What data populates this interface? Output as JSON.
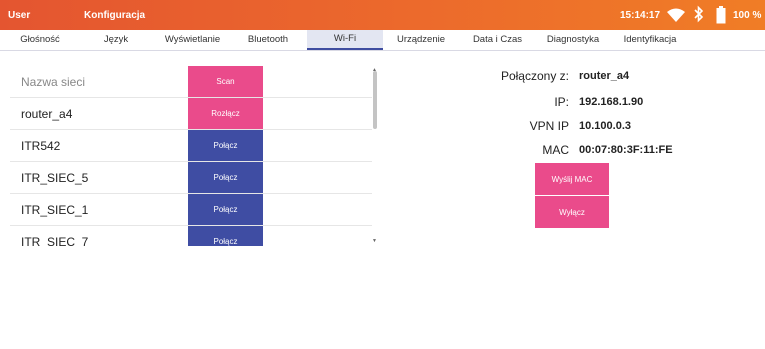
{
  "statusbar": {
    "user": "User",
    "title": "Konfiguracja",
    "time": "15:14:17",
    "battery": "100 %"
  },
  "tabs": [
    {
      "label": "Głośność"
    },
    {
      "label": "Język"
    },
    {
      "label": "Wyświetlanie"
    },
    {
      "label": "Bluetooth"
    },
    {
      "label": "Wi-Fi",
      "active": true
    },
    {
      "label": "Urządzenie"
    },
    {
      "label": "Data i Czas"
    },
    {
      "label": "Diagnostyka"
    },
    {
      "label": "Identyfikacja"
    }
  ],
  "networks": {
    "header": "Nazwa sieci",
    "scan_label": "Scan",
    "rows": [
      {
        "name": "router_a4",
        "action": "Rozłącz"
      },
      {
        "name": "ITR542",
        "action": "Połącz"
      },
      {
        "name": "ITR_SIEC_5",
        "action": "Połącz"
      },
      {
        "name": "ITR_SIEC_1",
        "action": "Połącz"
      },
      {
        "name": "ITR_SIEC_7",
        "action": "Połącz"
      }
    ]
  },
  "connection": {
    "connected_label": "Połączony z:",
    "connected_value": "router_a4",
    "ip_label": "IP:",
    "ip_value": "192.168.1.90",
    "vpn_label": "VPN IP",
    "vpn_value": "10.100.0.3",
    "mac_label": "MAC",
    "mac_value": "00:07:80:3F:11:FE",
    "send_mac_button": "Wyślij MAC",
    "off_button": "Wyłącz"
  },
  "colors": {
    "accent_pink": "#ea4b8b",
    "accent_blue": "#3f4da3",
    "topbar": "#ec6a2c"
  }
}
